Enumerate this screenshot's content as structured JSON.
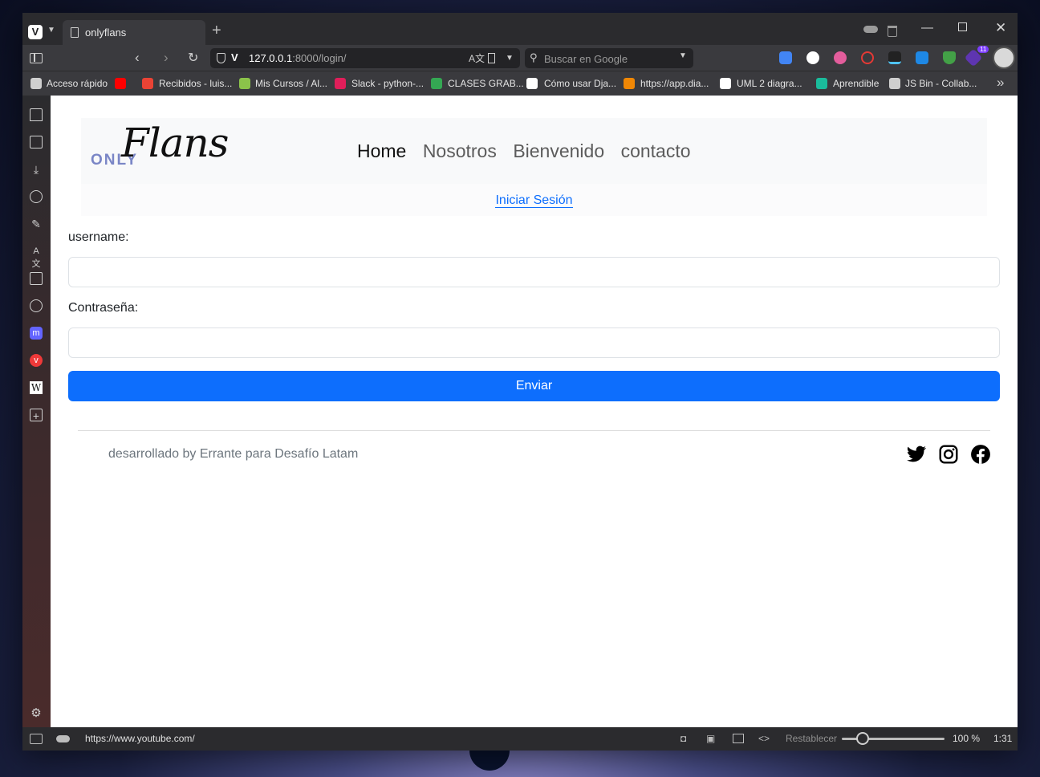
{
  "browser": {
    "tab_title": "onlyflans",
    "new_tab_symbol": "+",
    "url_host": "127.0.0.1",
    "url_rest": ":8000/login/",
    "search_placeholder": "Buscar en Google",
    "ext_badge_count": "11",
    "bookmarks": [
      {
        "label": "Acceso rápido",
        "icon": "quick-access-icon",
        "color": "#cfcfcf"
      },
      {
        "label": "Recibidos - luis...",
        "icon": "gmail-icon",
        "color": "#ea4335"
      },
      {
        "label": "Mis Cursos / Al...",
        "icon": "course-icon",
        "color": "#8bc34a"
      },
      {
        "label": "Slack - python-...",
        "icon": "slack-icon",
        "color": "#e01e5a"
      },
      {
        "label": "CLASES GRAB...",
        "icon": "drive-icon",
        "color": "#34a853"
      },
      {
        "label": "Cómo usar Dja...",
        "icon": "dev-icon",
        "color": "#ffffff"
      },
      {
        "label": "https://app.dia...",
        "icon": "diagrams-icon",
        "color": "#f08705"
      },
      {
        "label": "UML 2 diagra...",
        "icon": "uml-icon",
        "color": "#ffffff"
      },
      {
        "label": "Aprendible",
        "icon": "aprendible-icon",
        "color": "#1abc9c"
      },
      {
        "label": "JS Bin - Collab...",
        "icon": "jsbin-icon",
        "color": "#cfcfcf"
      }
    ],
    "status_url": "https://www.youtube.com/",
    "reset_label": "Restablecer",
    "zoom_level": "100 %",
    "clock": "1:31",
    "zoom_fraction": 0.2
  },
  "site": {
    "brand_small": "ONLY",
    "brand_big": "Flans",
    "brand_color": "#7a86c6",
    "nav": [
      "Home",
      "Nosotros",
      "Bienvenido",
      "contacto"
    ],
    "login_link": "Iniciar Sesión",
    "username_label": "username:",
    "password_label": "Contraseña:",
    "submit_label": "Enviar",
    "accent": "#0d6efd",
    "footer_text": "desarrollado by Errante para Desafío Latam",
    "social": [
      "twitter-icon",
      "instagram-icon",
      "facebook-icon"
    ]
  }
}
